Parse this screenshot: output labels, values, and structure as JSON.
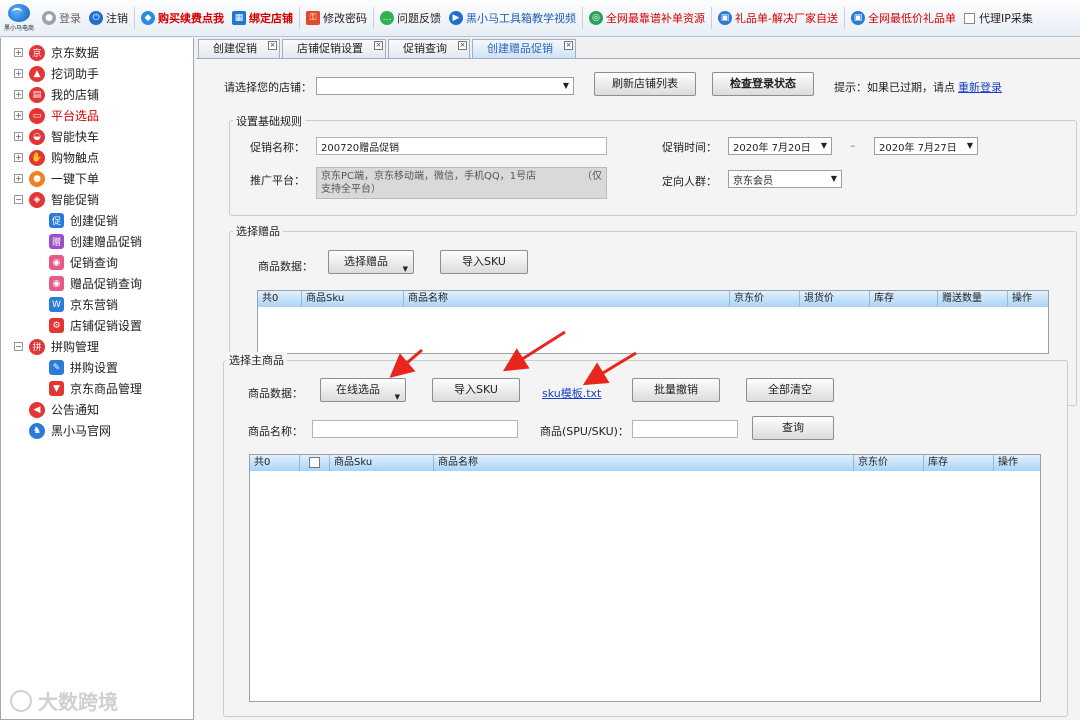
{
  "toolbar": {
    "logo_text": "黑小马电商",
    "items": {
      "login": "登录",
      "logout": "注销",
      "renew": "购买续费点我",
      "bind_shop": "绑定店铺",
      "change_password": "修改密码",
      "feedback": "问题反馈",
      "video": "黑小马工具箱教学视频",
      "resources": "全网最靠谱补单资源",
      "gift_list": "礼品单-解决厂家自送",
      "cheap_gift": "全网最低价礼品单",
      "proxy_ip": "代理IP采集"
    }
  },
  "sidebar": {
    "items": [
      {
        "label": "京东数据"
      },
      {
        "label": "挖词助手"
      },
      {
        "label": "我的店铺"
      },
      {
        "label": "平台选品"
      },
      {
        "label": "智能快车"
      },
      {
        "label": "购物触点"
      },
      {
        "label": "一键下单"
      },
      {
        "label": "智能促销"
      },
      {
        "label": "创建促销"
      },
      {
        "label": "创建赠品促销"
      },
      {
        "label": "促销查询"
      },
      {
        "label": "赠品促销查询"
      },
      {
        "label": "京东营销"
      },
      {
        "label": "店铺促销设置"
      },
      {
        "label": "拼购管理"
      },
      {
        "label": "拼购设置"
      },
      {
        "label": "京东商品管理"
      },
      {
        "label": "公告通知"
      },
      {
        "label": "黑小马官网"
      }
    ]
  },
  "tabs": [
    {
      "label": "创建促销"
    },
    {
      "label": "店铺促销设置"
    },
    {
      "label": "促销查询"
    },
    {
      "label": "创建赠品促销"
    }
  ],
  "shop": {
    "label": "请选择您的店铺：",
    "value": "",
    "refresh_button": "刷新店铺列表",
    "check_button": "检查登录状态",
    "hint": "提示：如果已过期，请点",
    "relogin_link": "重新登录"
  },
  "rules": {
    "title": "设置基础规则",
    "name_label": "促销名称：",
    "name_value": "200720赠品促销",
    "time_label": "促销时间：",
    "start_date": "2020年 7月20日",
    "dash": "–",
    "end_date": "2020年 7月27日",
    "platform_label": "推广平台：",
    "platform_value_1": "京东PC端，京东移动端，微信，手机QQ，1号店",
    "platform_value_tail": "（仅",
    "platform_value_2": "支持全平台）",
    "audience_label": "定向人群：",
    "audience_value": "京东会员"
  },
  "gift": {
    "title": "选择赠品",
    "data_label": "商品数据：",
    "select_button": "选择赠品",
    "import_button": "导入SKU",
    "columns": [
      "共0",
      "商品Sku",
      "商品名称",
      "京东价",
      "退货价",
      "库存",
      "赠送数量",
      "操作"
    ]
  },
  "main": {
    "title": "选择主商品",
    "data_label": "商品数据：",
    "online_button": "在线选品",
    "import_button": "导入SKU",
    "template_link": "sku模板.txt",
    "batch_cancel_button": "批量撤销",
    "clear_button": "全部清空",
    "name_label": "商品名称：",
    "name_value": "",
    "spu_label": "商品(SPU/SKU)：",
    "spu_value": "",
    "query_button": "查询",
    "columns": [
      "共0",
      "",
      "商品Sku",
      "商品名称",
      "京东价",
      "库存",
      "操作"
    ]
  },
  "watermark": "大数跨境",
  "colors": {
    "accent_red": "#d40000",
    "link_blue": "#1a3fc2",
    "arrow_red": "#e8261d",
    "grid_header": "#a9d3f5"
  }
}
